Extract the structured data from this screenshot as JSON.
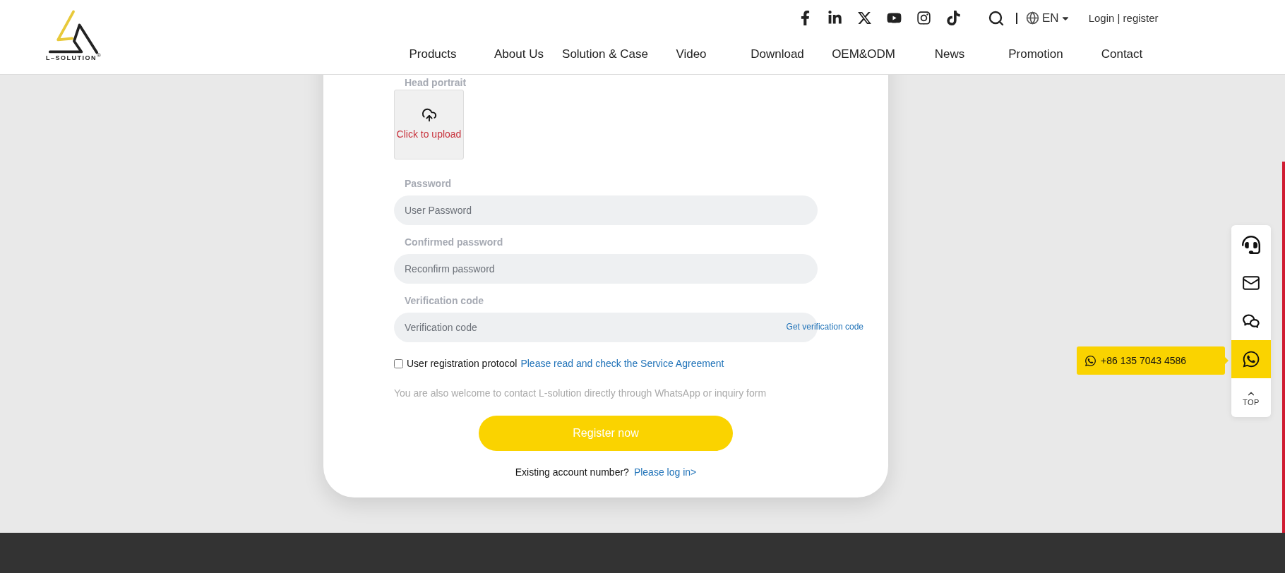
{
  "logo": {
    "wordmark": "L–SOLUTION",
    "registered_mark": "®"
  },
  "top_bar": {
    "language": "EN",
    "account_link": "Login | register"
  },
  "nav": [
    "Products",
    "About Us",
    "Solution & Case",
    "Video",
    "Download",
    "OEM&ODM",
    "News",
    "Promotion",
    "Contact"
  ],
  "form": {
    "upload": {
      "label": "Head portrait",
      "text": "Click to upload"
    },
    "fields": [
      {
        "label": "Password",
        "placeholder": "User Password"
      },
      {
        "label": "Confirmed password",
        "placeholder": "Reconfirm password"
      },
      {
        "label": "Verification code",
        "placeholder": "Verification code",
        "action": "Get verification code"
      }
    ],
    "agreement": {
      "checked": false,
      "label": "User registration protocol",
      "link": "Please read and check the Service Agreement"
    },
    "note": "You are also welcome to contact L-solution directly through WhatsApp or inquiry form",
    "submit": "Register now",
    "login_prompt": {
      "text": "Existing account number?",
      "link": "Please log in>"
    }
  },
  "contact_bar": {
    "items": [
      {
        "kind": "support",
        "selected": false
      },
      {
        "kind": "email",
        "selected": false
      },
      {
        "kind": "wechat",
        "selected": false
      },
      {
        "kind": "whatsapp",
        "selected": true
      },
      {
        "kind": "top",
        "selected": false,
        "label": "TOP"
      }
    ],
    "tooltip": "+86 135 7043 4586"
  }
}
